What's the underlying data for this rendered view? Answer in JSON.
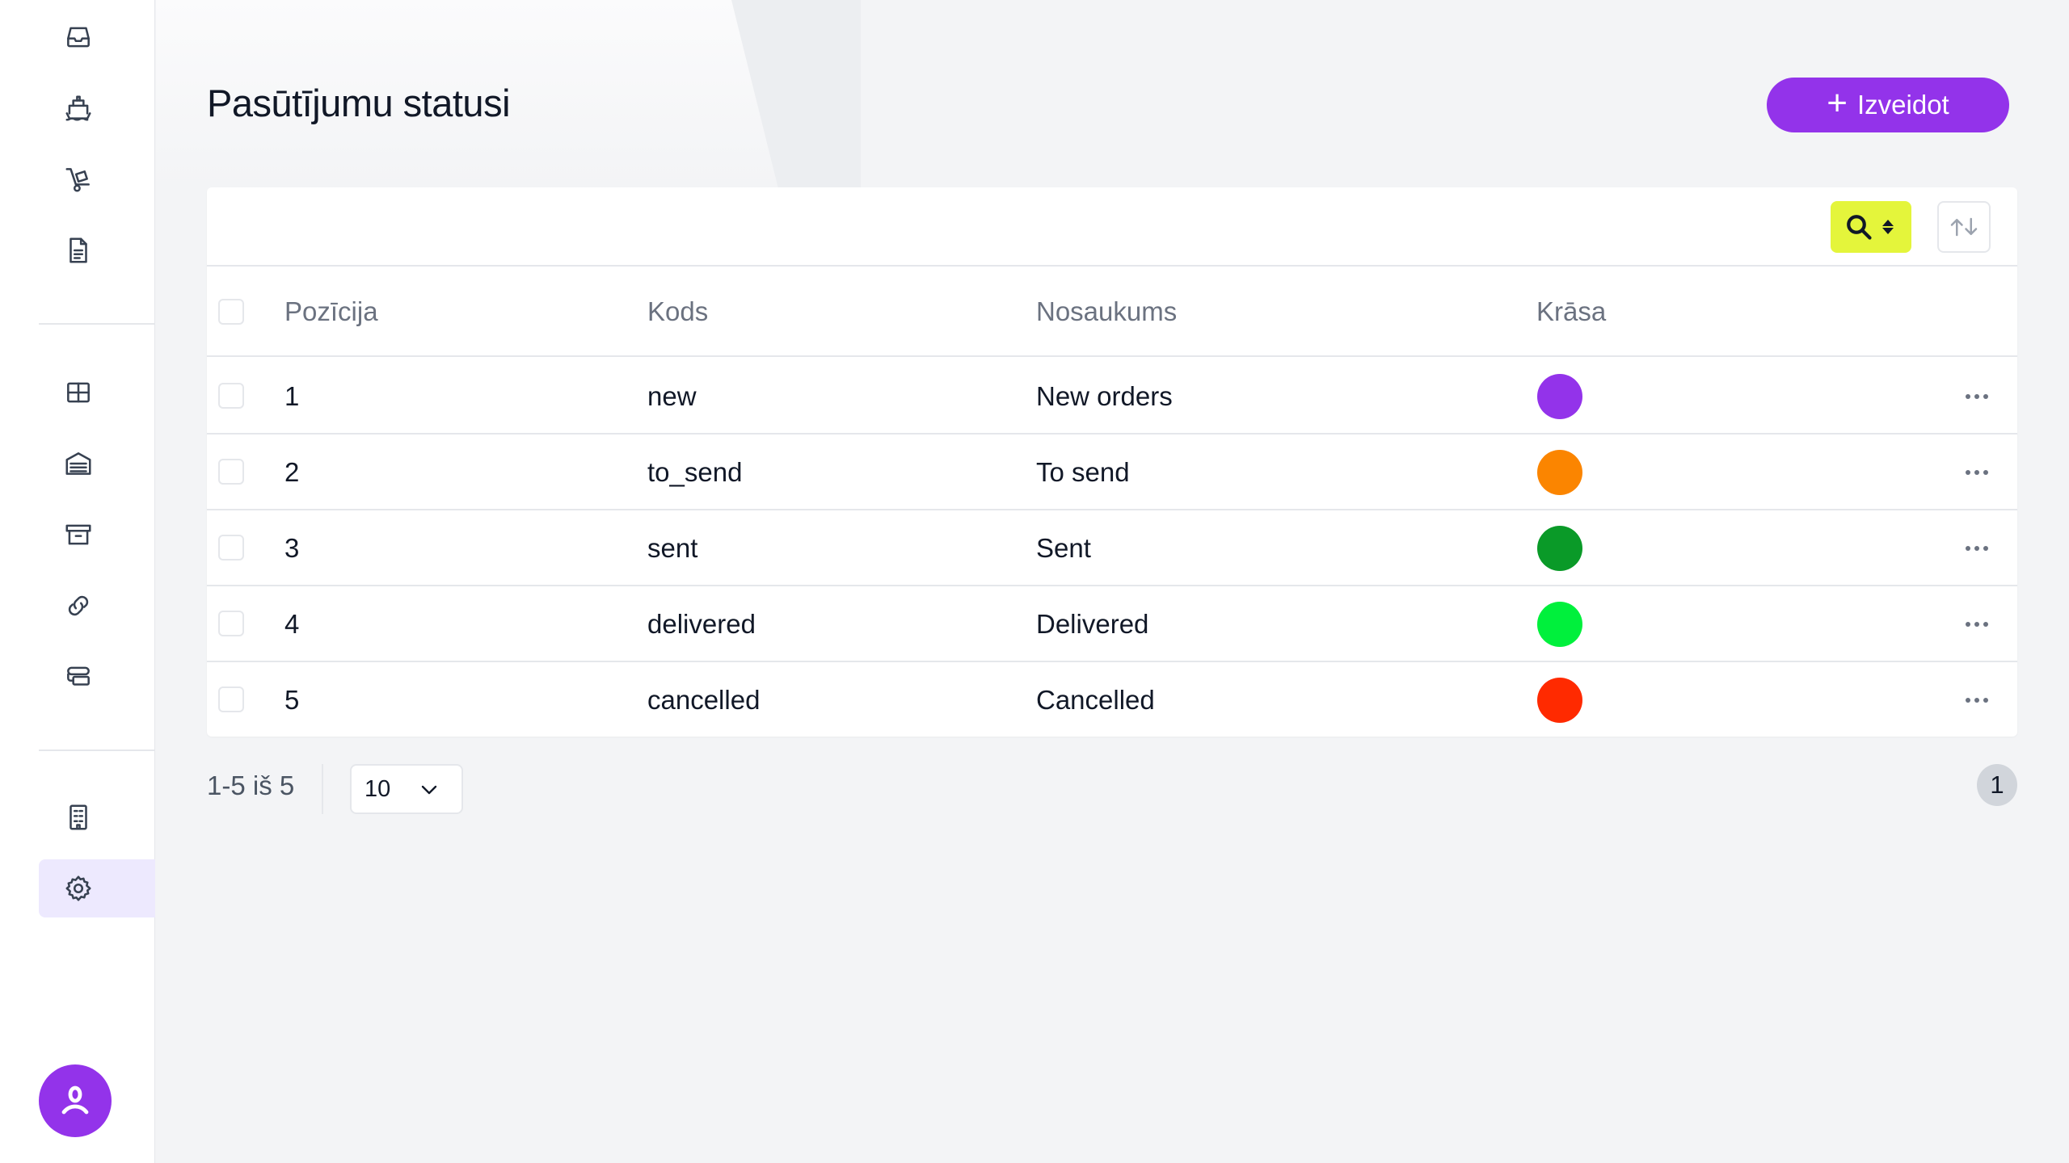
{
  "page": {
    "title": "Pasūtījumu statusi"
  },
  "actions": {
    "create_label": "Izveidot"
  },
  "sidebar": {
    "items": [
      {
        "icon": "inbox-icon"
      },
      {
        "icon": "ship-icon"
      },
      {
        "icon": "hand-truck-icon"
      },
      {
        "icon": "document-icon"
      },
      {
        "icon": "grid-icon"
      },
      {
        "icon": "warehouse-icon"
      },
      {
        "icon": "archive-icon"
      },
      {
        "icon": "link-icon"
      },
      {
        "icon": "conveyor-icon"
      },
      {
        "icon": "building-icon"
      },
      {
        "icon": "gear-icon",
        "active": true
      }
    ],
    "avatar_icon": "user-icon"
  },
  "table": {
    "columns": {
      "position": "Pozīcija",
      "code": "Kods",
      "name": "Nosaukums",
      "color": "Krāsa"
    },
    "rows": [
      {
        "position": "1",
        "code": "new",
        "name": "New orders",
        "color": "#9333ea"
      },
      {
        "position": "2",
        "code": "to_send",
        "name": "To send",
        "color": "#fb8500"
      },
      {
        "position": "3",
        "code": "sent",
        "name": "Sent",
        "color": "#0a9a28"
      },
      {
        "position": "4",
        "code": "delivered",
        "name": "Delivered",
        "color": "#00f03c"
      },
      {
        "position": "5",
        "code": "cancelled",
        "name": "Cancelled",
        "color": "#ff2a00"
      }
    ]
  },
  "pagination": {
    "range": "1-5 iš 5",
    "per_page": "10",
    "current_page": "1"
  }
}
